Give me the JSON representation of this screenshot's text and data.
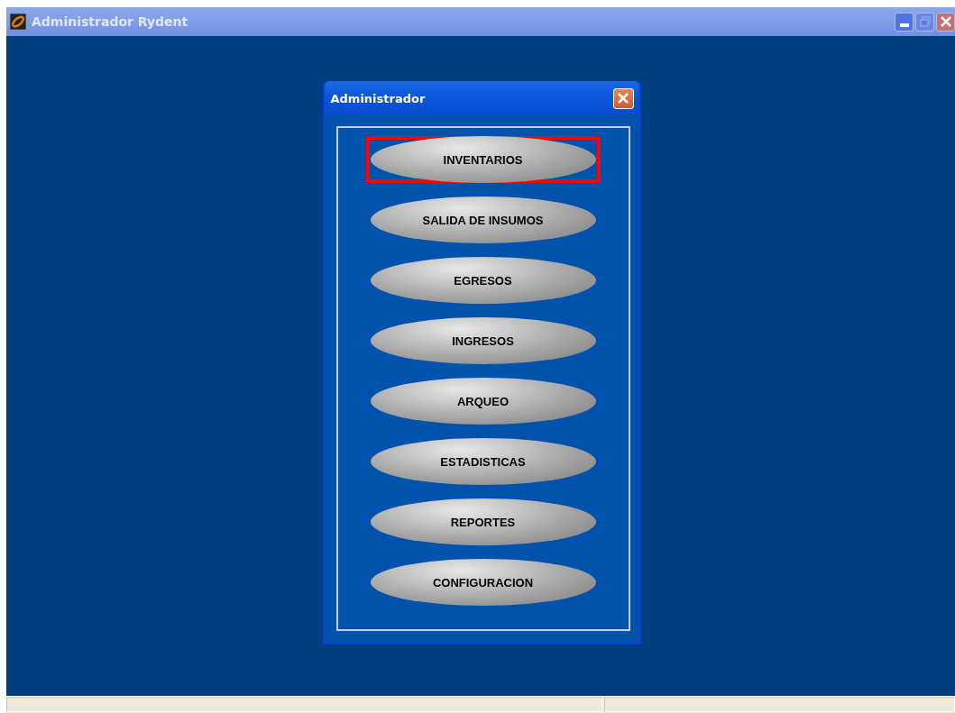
{
  "window": {
    "title": "Administrador Rydent"
  },
  "dialog": {
    "title": "Administrador",
    "buttons": [
      {
        "label": "INVENTARIOS",
        "selected": true
      },
      {
        "label": "SALIDA DE INSUMOS",
        "selected": false
      },
      {
        "label": "EGRESOS",
        "selected": false
      },
      {
        "label": "INGRESOS",
        "selected": false
      },
      {
        "label": "ARQUEO",
        "selected": false
      },
      {
        "label": "ESTADISTICAS",
        "selected": false
      },
      {
        "label": "REPORTES",
        "selected": false
      },
      {
        "label": "CONFIGURACION",
        "selected": false
      }
    ]
  }
}
